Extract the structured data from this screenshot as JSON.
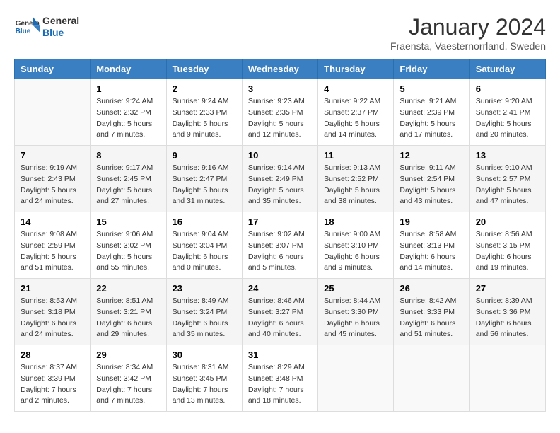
{
  "header": {
    "logo_line1": "General",
    "logo_line2": "Blue",
    "month": "January 2024",
    "location": "Fraensta, Vaesternorrland, Sweden"
  },
  "weekdays": [
    "Sunday",
    "Monday",
    "Tuesday",
    "Wednesday",
    "Thursday",
    "Friday",
    "Saturday"
  ],
  "weeks": [
    [
      {
        "day": "",
        "sunrise": "",
        "sunset": "",
        "daylight": ""
      },
      {
        "day": "1",
        "sunrise": "9:24 AM",
        "sunset": "2:32 PM",
        "daylight": "5 hours and 7 minutes."
      },
      {
        "day": "2",
        "sunrise": "9:24 AM",
        "sunset": "2:33 PM",
        "daylight": "5 hours and 9 minutes."
      },
      {
        "day": "3",
        "sunrise": "9:23 AM",
        "sunset": "2:35 PM",
        "daylight": "5 hours and 12 minutes."
      },
      {
        "day": "4",
        "sunrise": "9:22 AM",
        "sunset": "2:37 PM",
        "daylight": "5 hours and 14 minutes."
      },
      {
        "day": "5",
        "sunrise": "9:21 AM",
        "sunset": "2:39 PM",
        "daylight": "5 hours and 17 minutes."
      },
      {
        "day": "6",
        "sunrise": "9:20 AM",
        "sunset": "2:41 PM",
        "daylight": "5 hours and 20 minutes."
      }
    ],
    [
      {
        "day": "7",
        "sunrise": "9:19 AM",
        "sunset": "2:43 PM",
        "daylight": "5 hours and 24 minutes."
      },
      {
        "day": "8",
        "sunrise": "9:17 AM",
        "sunset": "2:45 PM",
        "daylight": "5 hours and 27 minutes."
      },
      {
        "day": "9",
        "sunrise": "9:16 AM",
        "sunset": "2:47 PM",
        "daylight": "5 hours and 31 minutes."
      },
      {
        "day": "10",
        "sunrise": "9:14 AM",
        "sunset": "2:49 PM",
        "daylight": "5 hours and 35 minutes."
      },
      {
        "day": "11",
        "sunrise": "9:13 AM",
        "sunset": "2:52 PM",
        "daylight": "5 hours and 38 minutes."
      },
      {
        "day": "12",
        "sunrise": "9:11 AM",
        "sunset": "2:54 PM",
        "daylight": "5 hours and 43 minutes."
      },
      {
        "day": "13",
        "sunrise": "9:10 AM",
        "sunset": "2:57 PM",
        "daylight": "5 hours and 47 minutes."
      }
    ],
    [
      {
        "day": "14",
        "sunrise": "9:08 AM",
        "sunset": "2:59 PM",
        "daylight": "5 hours and 51 minutes."
      },
      {
        "day": "15",
        "sunrise": "9:06 AM",
        "sunset": "3:02 PM",
        "daylight": "5 hours and 55 minutes."
      },
      {
        "day": "16",
        "sunrise": "9:04 AM",
        "sunset": "3:04 PM",
        "daylight": "6 hours and 0 minutes."
      },
      {
        "day": "17",
        "sunrise": "9:02 AM",
        "sunset": "3:07 PM",
        "daylight": "6 hours and 5 minutes."
      },
      {
        "day": "18",
        "sunrise": "9:00 AM",
        "sunset": "3:10 PM",
        "daylight": "6 hours and 9 minutes."
      },
      {
        "day": "19",
        "sunrise": "8:58 AM",
        "sunset": "3:13 PM",
        "daylight": "6 hours and 14 minutes."
      },
      {
        "day": "20",
        "sunrise": "8:56 AM",
        "sunset": "3:15 PM",
        "daylight": "6 hours and 19 minutes."
      }
    ],
    [
      {
        "day": "21",
        "sunrise": "8:53 AM",
        "sunset": "3:18 PM",
        "daylight": "6 hours and 24 minutes."
      },
      {
        "day": "22",
        "sunrise": "8:51 AM",
        "sunset": "3:21 PM",
        "daylight": "6 hours and 29 minutes."
      },
      {
        "day": "23",
        "sunrise": "8:49 AM",
        "sunset": "3:24 PM",
        "daylight": "6 hours and 35 minutes."
      },
      {
        "day": "24",
        "sunrise": "8:46 AM",
        "sunset": "3:27 PM",
        "daylight": "6 hours and 40 minutes."
      },
      {
        "day": "25",
        "sunrise": "8:44 AM",
        "sunset": "3:30 PM",
        "daylight": "6 hours and 45 minutes."
      },
      {
        "day": "26",
        "sunrise": "8:42 AM",
        "sunset": "3:33 PM",
        "daylight": "6 hours and 51 minutes."
      },
      {
        "day": "27",
        "sunrise": "8:39 AM",
        "sunset": "3:36 PM",
        "daylight": "6 hours and 56 minutes."
      }
    ],
    [
      {
        "day": "28",
        "sunrise": "8:37 AM",
        "sunset": "3:39 PM",
        "daylight": "7 hours and 2 minutes."
      },
      {
        "day": "29",
        "sunrise": "8:34 AM",
        "sunset": "3:42 PM",
        "daylight": "7 hours and 7 minutes."
      },
      {
        "day": "30",
        "sunrise": "8:31 AM",
        "sunset": "3:45 PM",
        "daylight": "7 hours and 13 minutes."
      },
      {
        "day": "31",
        "sunrise": "8:29 AM",
        "sunset": "3:48 PM",
        "daylight": "7 hours and 18 minutes."
      },
      {
        "day": "",
        "sunrise": "",
        "sunset": "",
        "daylight": ""
      },
      {
        "day": "",
        "sunrise": "",
        "sunset": "",
        "daylight": ""
      },
      {
        "day": "",
        "sunrise": "",
        "sunset": "",
        "daylight": ""
      }
    ]
  ],
  "labels": {
    "sunrise_prefix": "Sunrise: ",
    "sunset_prefix": "Sunset: ",
    "daylight_prefix": "Daylight: "
  }
}
